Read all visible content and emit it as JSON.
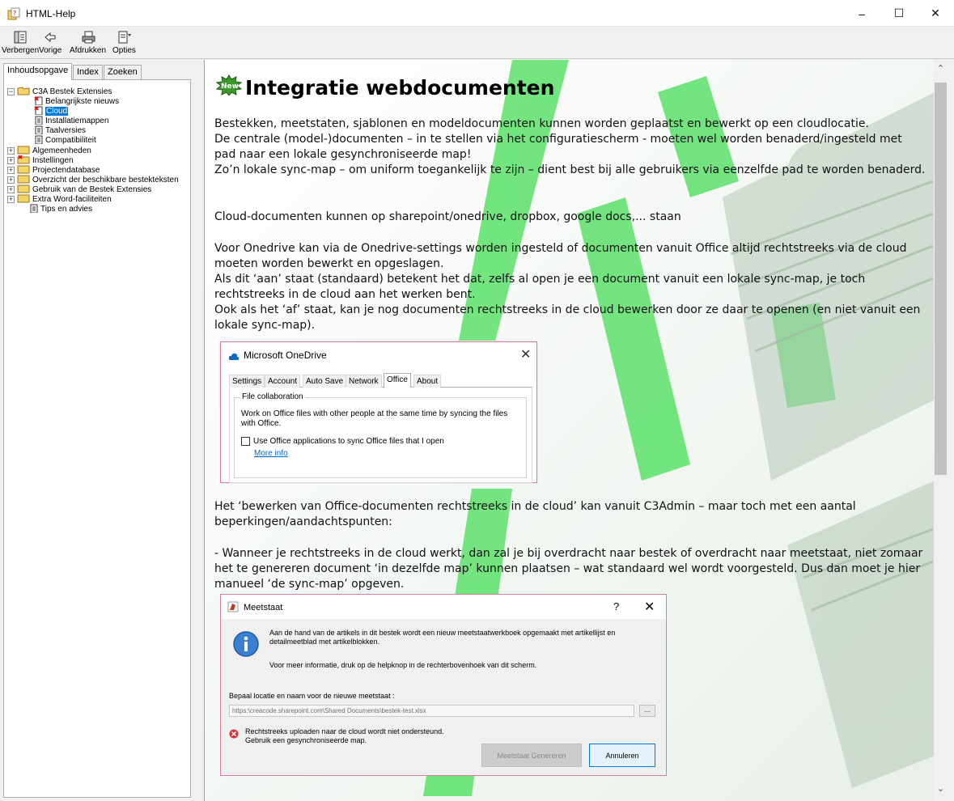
{
  "window": {
    "title": "HTML-Help",
    "min": "–",
    "max": "☐",
    "close": "✕"
  },
  "toolbar": {
    "hide": "Verbergen",
    "back": "Vorige",
    "print": "Afdrukken",
    "options": "Opties"
  },
  "tabs": {
    "contents": "Inhoudsopgave",
    "index": "Index",
    "search": "Zoeken"
  },
  "tree": [
    {
      "label": "C3A Bestek Extensies",
      "expander": "−"
    },
    {
      "label": "Belangrijkste nieuws"
    },
    {
      "label": "Cloud"
    },
    {
      "label": "Installatiemappen"
    },
    {
      "label": "Taalversies"
    },
    {
      "label": "Compatibiliteit"
    },
    {
      "label": "Algemeenheden",
      "expander": "+"
    },
    {
      "label": "Instellingen",
      "expander": "+"
    },
    {
      "label": "Projectendatabase",
      "expander": "+"
    },
    {
      "label": "Overzicht der beschikbare bestekteksten",
      "expander": "+"
    },
    {
      "label": "Gebruik van de Bestek Extensies",
      "expander": "+"
    },
    {
      "label": "Extra Word-faciliteiten",
      "expander": "+"
    },
    {
      "label": "Tips en advies"
    }
  ],
  "page": {
    "badge": "New",
    "title": "Integratie webdocumenten",
    "p1": "Bestekken, meetstaten, sjablonen en modeldocumenten kunnen worden geplaatst en bewerkt op een cloudlocatie.",
    "p2": "De centrale (model-)documenten – in te stellen via het configuratiescherm - moeten wel worden benaderd/ingesteld met pad naar een lokale gesynchroniseerde map!",
    "p3": "Zo’n lokale sync-map – om uniform toegankelijk te zijn – dient best bij alle gebruikers via eenzelfde pad te worden benaderd.",
    "p4": "Cloud-documenten kunnen op sharepoint/onedrive, dropbox, google docs,... staan",
    "p5": "Voor Onedrive kan via de Onedrive-settings worden ingesteld of documenten vanuit Office altijd rechtstreeks via de cloud moeten worden bewerkt en opgeslagen.",
    "p6": "Als dit ‘aan’ staat (standaard) betekent het dat, zelfs al open je een document vanuit een lokale sync-map, je toch rechtstreeks in de cloud aan het werken bent.",
    "p7": "Ook als het ‘af’ staat, kan je nog documenten rechtstreeks in de cloud bewerken door ze daar te openen (en niet vanuit een lokale sync-map).",
    "p8": "Het ‘bewerken van Office-documenten rechtstreeks in de cloud’ kan vanuit C3Admin – maar toch met een aantal beperkingen/aandachtspunten:",
    "p9": "- Wanneer je rechtstreeks in de cloud werkt, dan zal je bij overdracht naar bestek of overdracht naar meetstaat, niet zomaar het te genereren document ‘in dezelfde map’ kunnen plaatsen – wat standaard wel wordt voorgesteld. Dus dan moet je hier manueel ‘de sync-map’ opgeven."
  },
  "onedrive": {
    "title": "Microsoft OneDrive",
    "close": "✕",
    "tabs": [
      "Settings",
      "Account",
      "Auto Save",
      "Network",
      "Office",
      "About"
    ],
    "group": "File collaboration",
    "desc": "Work on Office files with other people at the same time by syncing the files with Office.",
    "checkbox": "Use Office applications to sync Office files that I open",
    "link": "More info"
  },
  "meetstaat": {
    "title": "Meetstaat",
    "help": "?",
    "close": "✕",
    "text1": "Aan de hand van de artikels in dit bestek wordt een nieuw meetstaatwerkboek opgemaakt met artikellijst en detailmeetblad met artikelblokken.",
    "text2": "Voor meer informatie, druk op de helpknop in de rechterbovenhoek van dit scherm.",
    "label": "Bepaal locatie en naam voor de nieuwe meetstaat :",
    "path": "https:\\creacode.sharepoint.com\\Shared Documents\\bestek-test.xlsx",
    "browse": "...",
    "error": "Rechtstreeks uploaden naar de cloud wordt niet ondersteund. Gebruik een gesynchroniseerde map.",
    "generate": "Meetstaat Genereren",
    "cancel": "Annuleren"
  },
  "scroll": {
    "up": "⌃",
    "down": "⌄"
  },
  "colors": {
    "accent": "#0078d7",
    "green": "#5ce06a",
    "error": "#d13438"
  }
}
